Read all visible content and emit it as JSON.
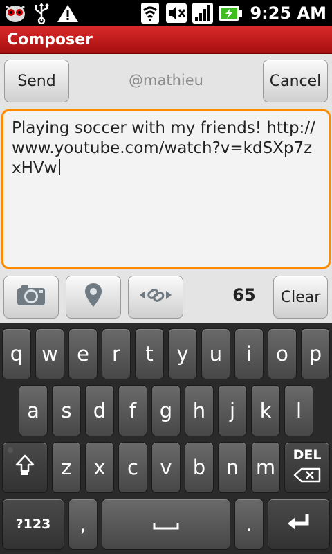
{
  "status_bar": {
    "time": "9:25 AM",
    "icons": [
      "app-notification-icon",
      "usb-icon",
      "warning-icon",
      "wifi-icon",
      "muted-icon",
      "signal-icon",
      "battery-charging-icon"
    ]
  },
  "title_bar": {
    "title": "Composer"
  },
  "header": {
    "send_label": "Send",
    "recipient": "@mathieu",
    "cancel_label": "Cancel"
  },
  "composer": {
    "text": "Playing soccer with my friends! http://www.youtube.com/watch?v=kdSXp7zxHVw"
  },
  "toolbar": {
    "icons": [
      "camera-icon",
      "location-pin-icon",
      "link-icon"
    ],
    "char_count": "65",
    "clear_label": "Clear"
  },
  "keyboard": {
    "row1": [
      "q",
      "w",
      "e",
      "r",
      "t",
      "y",
      "u",
      "i",
      "o",
      "p"
    ],
    "row2": [
      "a",
      "s",
      "d",
      "f",
      "g",
      "h",
      "j",
      "k",
      "l"
    ],
    "row3": [
      "z",
      "x",
      "c",
      "v",
      "b",
      "n",
      "m"
    ],
    "del_label": "DEL",
    "symbols_label": "?123",
    "comma": ",",
    "period": "."
  },
  "colors": {
    "title_bar": "#c41a1a",
    "focus_border": "#ff8a00",
    "keyboard_bg": "#2a2a2a"
  }
}
